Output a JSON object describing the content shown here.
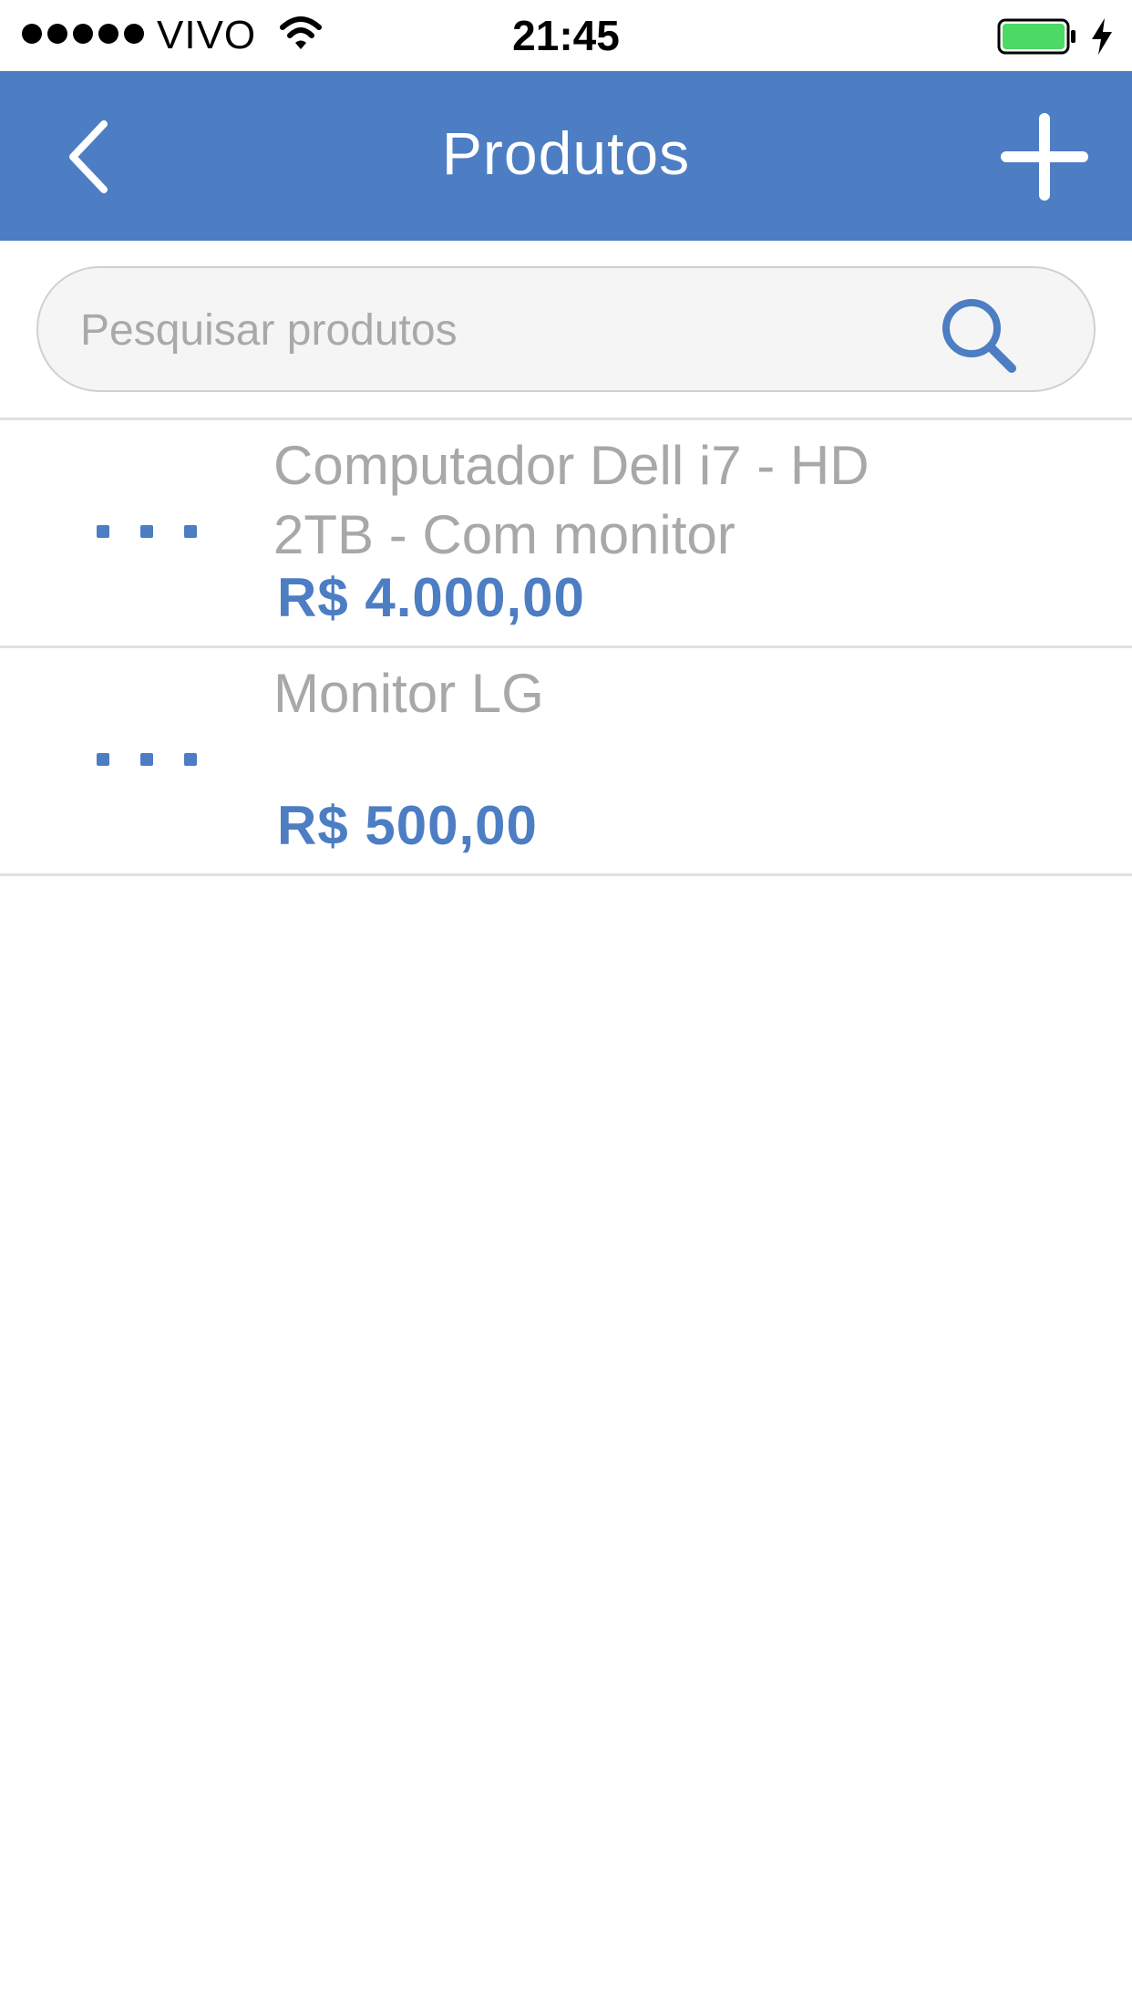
{
  "status_bar": {
    "carrier": "VIVO",
    "time": "21:45",
    "battery_color": "#4cd964"
  },
  "nav": {
    "title": "Produtos",
    "back_icon": "chevron-left-icon",
    "add_icon": "plus-icon",
    "background_color": "#4d7dc3"
  },
  "search": {
    "placeholder": "Pesquisar produtos",
    "value": "",
    "icon": "search-icon"
  },
  "products": [
    {
      "name": "Computador Dell i7 - HD 2TB - Com monitor",
      "price": "R$ 4.000,00"
    },
    {
      "name": "Monitor LG",
      "price": "R$ 500,00"
    }
  ]
}
